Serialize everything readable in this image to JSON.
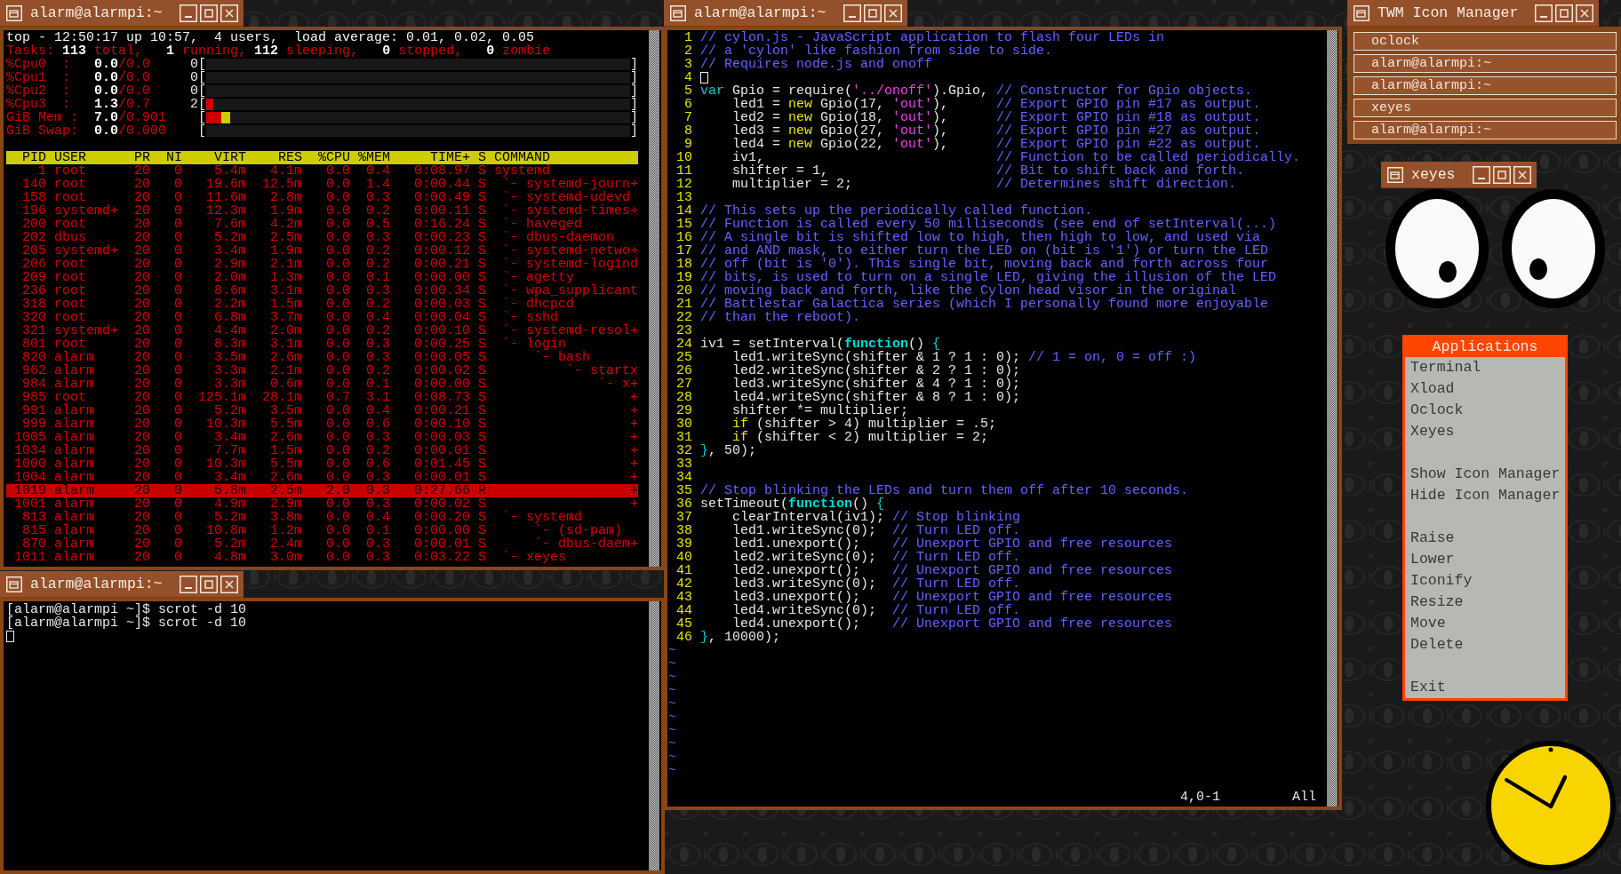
{
  "top_window": {
    "title": "alarm@alarmpi:~",
    "summary": "top - 12:50:17 up 10:57,  4 users,  load average: 0.01, 0.02, 0.05",
    "tasks": "Tasks: **113** total,   **1** running, **112** sleeping,   **0** stopped,   **0** zombie",
    "meters": [
      {
        "label": "%Cpu0  :",
        "reading": "**0.0**/0.0",
        "start": "0[",
        "end": "]"
      },
      {
        "label": "%Cpu1  :",
        "reading": "**0.0**/0.0",
        "start": "0[",
        "end": "]"
      },
      {
        "label": "%Cpu2  :",
        "reading": "**0.0**/0.0",
        "start": "0[",
        "end": "]"
      },
      {
        "label": "%Cpu3  :",
        "reading": "**1.3**/0.7",
        "start": "2[",
        "end": "]",
        "segments": [
          {
            "color": "#cd0000",
            "level": 0.017
          }
        ]
      },
      {
        "label": "GiB Mem :",
        "reading": "**7.0**/0.901",
        "start": "[",
        "end": "]",
        "segments": [
          {
            "color": "#cd0000",
            "level": 0.036
          },
          {
            "color": "#cdcd00",
            "level": 0.02
          }
        ]
      },
      {
        "label": "GiB Swap:",
        "reading": "**0.0**/0.000",
        "start": "[",
        "end": "]"
      }
    ],
    "table": {
      "columns": [
        "PID",
        "USER",
        "PR",
        "NI",
        "VIRT",
        "RES",
        "%CPU",
        "%MEM",
        "TIME+",
        "S",
        "COMMAND"
      ],
      "rows": [
        {
          "cells": [
            "1",
            "root",
            "20",
            "0",
            "5.4m",
            "4.1m",
            "0.0",
            "0.4",
            "0:08.97",
            "S"
          ],
          "command": "systemd",
          "highlighted": false,
          "children": [
            {
              "cells": [
                "140",
                "root",
                "20",
                "0",
                "19.6m",
                "12.5m",
                "0.0",
                "1.4",
                "0:00.44",
                "S"
              ],
              "command": "`- systemd-journ+",
              "highlighted": false
            },
            {
              "cells": [
                "158",
                "root",
                "20",
                "0",
                "11.6m",
                "2.8m",
                "0.0",
                "0.3",
                "0:00.49",
                "S"
              ],
              "command": "`- systemd-udevd",
              "highlighted": false
            },
            {
              "cells": [
                "196",
                "systemd+",
                "20",
                "0",
                "12.3m",
                "1.9m",
                "0.0",
                "0.2",
                "0:00.11",
                "S"
              ],
              "command": "`- systemd-times+",
              "highlighted": false
            },
            {
              "cells": [
                "200",
                "root",
                "20",
                "0",
                "7.6m",
                "4.2m",
                "0.0",
                "0.5",
                "0:16.24",
                "S"
              ],
              "command": "`- haveged",
              "highlighted": false
            },
            {
              "cells": [
                "202",
                "dbus",
                "20",
                "0",
                "5.2m",
                "2.5m",
                "0.0",
                "0.3",
                "0:00.23",
                "S"
              ],
              "command": "`- dbus-daemon",
              "highlighted": false
            },
            {
              "cells": [
                "205",
                "systemd+",
                "20",
                "0",
                "3.4m",
                "1.9m",
                "0.0",
                "0.2",
                "0:00.12",
                "S"
              ],
              "command": "`- systemd-netwo+",
              "highlighted": false
            },
            {
              "cells": [
                "206",
                "root",
                "20",
                "0",
                "2.9m",
                "2.1m",
                "0.0",
                "0.2",
                "0:00.21",
                "S"
              ],
              "command": "`- systemd-logind",
              "highlighted": false
            },
            {
              "cells": [
                "209",
                "root",
                "20",
                "0",
                "2.0m",
                "1.3m",
                "0.0",
                "0.1",
                "0:00.00",
                "S"
              ],
              "command": "`- agetty",
              "highlighted": false
            },
            {
              "cells": [
                "236",
                "root",
                "20",
                "0",
                "8.6m",
                "3.1m",
                "0.0",
                "0.3",
                "0:00.34",
                "S"
              ],
              "command": "`- wpa_supplicant",
              "highlighted": false
            },
            {
              "cells": [
                "318",
                "root",
                "20",
                "0",
                "2.2m",
                "1.5m",
                "0.0",
                "0.2",
                "0:00.03",
                "S"
              ],
              "command": "`- dhcpcd",
              "highlighted": false
            },
            {
              "cells": [
                "320",
                "root",
                "20",
                "0",
                "6.8m",
                "3.7m",
                "0.0",
                "0.4",
                "0:00.04",
                "S"
              ],
              "command": "`- sshd",
              "highlighted": false
            },
            {
              "cells": [
                "321",
                "systemd+",
                "20",
                "0",
                "4.4m",
                "2.0m",
                "0.0",
                "0.2",
                "0:00.10",
                "S"
              ],
              "command": "`- systemd-resol+",
              "highlighted": false
            },
            {
              "cells": [
                "801",
                "root",
                "20",
                "0",
                "8.3m",
                "3.1m",
                "0.0",
                "0.3",
                "0:00.25",
                "S"
              ],
              "command": "`- login",
              "highlighted": false,
              "children": [
                {
                  "cells": [
                    "820",
                    "alarm",
                    "20",
                    "0",
                    "3.5m",
                    "2.6m",
                    "0.0",
                    "0.3",
                    "0:00.05",
                    "S"
                  ],
                  "command": "`- bash",
                  "highlighted": false,
                  "children": [
                    {
                      "cells": [
                        "962",
                        "alarm",
                        "20",
                        "0",
                        "3.3m",
                        "2.1m",
                        "0.0",
                        "0.2",
                        "0:00.02",
                        "S"
                      ],
                      "command": "`- startx",
                      "highlighted": false,
                      "children": [
                        {
                          "cells": [
                            "984",
                            "alarm",
                            "20",
                            "0",
                            "3.3m",
                            "0.6m",
                            "0.0",
                            "0.1",
                            "0:00.00",
                            "S"
                          ],
                          "command": "`- x+",
                          "highlighted": false,
                          "children": [
                            {
                              "cells": [
                                "985",
                                "root",
                                "20",
                                "0",
                                "125.1m",
                                "28.1m",
                                "0.7",
                                "3.1",
                                "0:08.73",
                                "S"
                              ],
                              "command": "+",
                              "highlighted": false
                            },
                            {
                              "cells": [
                                "991",
                                "alarm",
                                "20",
                                "0",
                                "5.2m",
                                "3.5m",
                                "0.0",
                                "0.4",
                                "0:00.21",
                                "S"
                              ],
                              "command": "+",
                              "highlighted": false
                            },
                            {
                              "cells": [
                                "999",
                                "alarm",
                                "20",
                                "0",
                                "10.3m",
                                "5.5m",
                                "0.0",
                                "0.6",
                                "0:00.10",
                                "S"
                              ],
                              "command": "+",
                              "highlighted": false
                            },
                            {
                              "cells": [
                                "1005",
                                "alarm",
                                "20",
                                "0",
                                "3.4m",
                                "2.6m",
                                "0.0",
                                "0.3",
                                "0:00.03",
                                "S"
                              ],
                              "command": "+",
                              "highlighted": false
                            },
                            {
                              "cells": [
                                "1034",
                                "alarm",
                                "20",
                                "0",
                                "7.7m",
                                "1.5m",
                                "0.0",
                                "0.2",
                                "0:00.01",
                                "S"
                              ],
                              "command": "+",
                              "highlighted": false
                            },
                            {
                              "cells": [
                                "1000",
                                "alarm",
                                "20",
                                "0",
                                "10.3m",
                                "5.5m",
                                "0.0",
                                "0.6",
                                "0:01.45",
                                "S"
                              ],
                              "command": "+",
                              "highlighted": false
                            },
                            {
                              "cells": [
                                "1004",
                                "alarm",
                                "20",
                                "0",
                                "3.4m",
                                "2.6m",
                                "0.0",
                                "0.3",
                                "0:00.01",
                                "S"
                              ],
                              "command": "+",
                              "highlighted": false
                            },
                            {
                              "cells": [
                                "1019",
                                "alarm",
                                "20",
                                "0",
                                "5.8m",
                                "2.5m",
                                "2.0",
                                "0.3",
                                "0:27.66",
                                "R"
                              ],
                              "command": "+",
                              "highlighted": true
                            },
                            {
                              "cells": [
                                "1001",
                                "alarm",
                                "20",
                                "0",
                                "4.9m",
                                "2.9m",
                                "0.0",
                                "0.3",
                                "0:00.02",
                                "S"
                              ],
                              "command": "+",
                              "highlighted": false
                            }
                          ]
                        }
                      ]
                    }
                  ]
                }
              ]
            },
            {
              "cells": [
                "813",
                "alarm",
                "20",
                "0",
                "5.2m",
                "3.8m",
                "0.0",
                "0.4",
                "0:00.20",
                "S"
              ],
              "command": "`- systemd",
              "highlighted": false,
              "children": [
                {
                  "cells": [
                    "815",
                    "alarm",
                    "20",
                    "0",
                    "10.8m",
                    "1.2m",
                    "0.0",
                    "0.1",
                    "0:00.00",
                    "S"
                  ],
                  "command": "`- (sd-pam)",
                  "highlighted": false
                },
                {
                  "cells": [
                    "870",
                    "alarm",
                    "20",
                    "0",
                    "5.2m",
                    "2.4m",
                    "0.0",
                    "0.3",
                    "0:00.01",
                    "S"
                  ],
                  "command": "`- dbus-daem+",
                  "highlighted": false
                }
              ]
            },
            {
              "cells": [
                "1011",
                "alarm",
                "20",
                "0",
                "4.8m",
                "3.0m",
                "0.0",
                "0.3",
                "0:03.22",
                "S"
              ],
              "command": "`- xeyes",
              "highlighted": false
            }
          ]
        }
      ]
    }
  },
  "code_window": {
    "title": "alarm@alarmpi:~",
    "lines": [
      {
        "number": "1",
        "tokens": [
          {
            "kind": "comment",
            "text": "// cylon.js - JavaScript application to flash four LEDs in"
          }
        ]
      },
      {
        "number": "2",
        "tokens": [
          {
            "kind": "comment",
            "text": "// a 'cylon' like fashion from side to side."
          }
        ]
      },
      {
        "number": "3",
        "tokens": [
          {
            "kind": "comment",
            "text": "// Requires node.js and onoff"
          }
        ]
      },
      {
        "number": "4",
        "tokens": [
          {
            "kind": "cursor"
          }
        ]
      },
      {
        "number": "5",
        "tokens": [
          {
            "kind": "keyword",
            "text": "var"
          },
          {
            "kind": "plain",
            "text": " Gpio = require("
          },
          {
            "kind": "string",
            "text": "'../onoff'"
          },
          {
            "kind": "plain",
            "text": ").Gpio, "
          },
          {
            "kind": "comment",
            "text": "// Constructor for Gpio objects."
          }
        ]
      },
      {
        "number": "6",
        "tokens": [
          {
            "kind": "plain",
            "text": "    led1 = "
          },
          {
            "kind": "statement",
            "text": "new"
          },
          {
            "kind": "plain",
            "text": " Gpio(17, "
          },
          {
            "kind": "string",
            "text": "'out'"
          },
          {
            "kind": "plain",
            "text": "),      "
          },
          {
            "kind": "comment",
            "text": "// Export GPIO pin #17 as output."
          }
        ]
      },
      {
        "number": "7",
        "tokens": [
          {
            "kind": "plain",
            "text": "    led2 = "
          },
          {
            "kind": "statement",
            "text": "new"
          },
          {
            "kind": "plain",
            "text": " Gpio(18, "
          },
          {
            "kind": "string",
            "text": "'out'"
          },
          {
            "kind": "plain",
            "text": "),      "
          },
          {
            "kind": "comment",
            "text": "// Export GPIO pin #18 as output."
          }
        ]
      },
      {
        "number": "8",
        "tokens": [
          {
            "kind": "plain",
            "text": "    led3 = "
          },
          {
            "kind": "statement",
            "text": "new"
          },
          {
            "kind": "plain",
            "text": " Gpio(27, "
          },
          {
            "kind": "string",
            "text": "'out'"
          },
          {
            "kind": "plain",
            "text": "),      "
          },
          {
            "kind": "comment",
            "text": "// Export GPIO pin #27 as output."
          }
        ]
      },
      {
        "number": "9",
        "tokens": [
          {
            "kind": "plain",
            "text": "    led4 = "
          },
          {
            "kind": "statement",
            "text": "new"
          },
          {
            "kind": "plain",
            "text": " Gpio(22, "
          },
          {
            "kind": "string",
            "text": "'out'"
          },
          {
            "kind": "plain",
            "text": "),      "
          },
          {
            "kind": "comment",
            "text": "// Export GPIO pin #22 as output."
          }
        ]
      },
      {
        "number": "10",
        "tokens": [
          {
            "kind": "plain",
            "text": "    iv1,                             "
          },
          {
            "kind": "comment",
            "text": "// Function to be called periodically."
          }
        ]
      },
      {
        "number": "11",
        "tokens": [
          {
            "kind": "plain",
            "text": "    shifter = 1,                     "
          },
          {
            "kind": "comment",
            "text": "// Bit to shift back and forth."
          }
        ]
      },
      {
        "number": "12",
        "tokens": [
          {
            "kind": "plain",
            "text": "    multiplier = 2;                  "
          },
          {
            "kind": "comment",
            "text": "// Determines shift direction."
          }
        ]
      },
      {
        "number": "13"
      },
      {
        "number": "14",
        "tokens": [
          {
            "kind": "comment",
            "text": "// This sets up the periodically called function."
          }
        ]
      },
      {
        "number": "15",
        "tokens": [
          {
            "kind": "comment",
            "text": "// Function is called every 50 milliseconds (see end of setInterval(...)"
          }
        ]
      },
      {
        "number": "16",
        "tokens": [
          {
            "kind": "comment",
            "text": "// A single bit is shifted low to high, then high to low, and used via"
          }
        ]
      },
      {
        "number": "17",
        "tokens": [
          {
            "kind": "comment",
            "text": "// and AND mask, to either turn the LED on (bit is '1') or turn the LED"
          }
        ]
      },
      {
        "number": "18",
        "tokens": [
          {
            "kind": "comment",
            "text": "// off (bit is '0'). This single bit, moving back and forth across four"
          }
        ]
      },
      {
        "number": "19",
        "tokens": [
          {
            "kind": "comment",
            "text": "// bits, is used to turn on a single LED, giving the illusion of the LED"
          }
        ]
      },
      {
        "number": "20",
        "tokens": [
          {
            "kind": "comment",
            "text": "// moving back and forth, like the Cylon head visor in the original"
          }
        ]
      },
      {
        "number": "21",
        "tokens": [
          {
            "kind": "comment",
            "text": "// Battlestar Galactica series (which I personally found more enjoyable"
          }
        ]
      },
      {
        "number": "22",
        "tokens": [
          {
            "kind": "comment",
            "text": "// than the reboot)."
          }
        ]
      },
      {
        "number": "23"
      },
      {
        "number": "24",
        "tokens": [
          {
            "kind": "plain",
            "text": "iv1 = setInterval("
          },
          {
            "kind": "function",
            "text": "function"
          },
          {
            "kind": "plain",
            "text": "() "
          },
          {
            "kind": "brace",
            "text": "{"
          }
        ]
      },
      {
        "number": "25",
        "tokens": [
          {
            "kind": "plain",
            "text": "    led1.writeSync(shifter & 1 ? 1 : 0); "
          },
          {
            "kind": "comment",
            "text": "// 1 = on, 0 = off :)"
          }
        ]
      },
      {
        "number": "26",
        "tokens": [
          {
            "kind": "plain",
            "text": "    led2.writeSync(shifter & 2 ? 1 : 0);"
          }
        ]
      },
      {
        "number": "27",
        "tokens": [
          {
            "kind": "plain",
            "text": "    led3.writeSync(shifter & 4 ? 1 : 0);"
          }
        ]
      },
      {
        "number": "28",
        "tokens": [
          {
            "kind": "plain",
            "text": "    led4.writeSync(shifter & 8 ? 1 : 0);"
          }
        ]
      },
      {
        "number": "29",
        "tokens": [
          {
            "kind": "plain",
            "text": "    shifter *= multiplier;"
          }
        ]
      },
      {
        "number": "30",
        "tokens": [
          {
            "kind": "statement",
            "text": "    if"
          },
          {
            "kind": "plain",
            "text": " (shifter > 4) multiplier = .5;"
          }
        ]
      },
      {
        "number": "31",
        "tokens": [
          {
            "kind": "statement",
            "text": "    if"
          },
          {
            "kind": "plain",
            "text": " (shifter < 2) multiplier = 2;"
          }
        ]
      },
      {
        "number": "32",
        "tokens": [
          {
            "kind": "brace",
            "text": "}"
          },
          {
            "kind": "plain",
            "text": ", 50);"
          }
        ]
      },
      {
        "number": "33"
      },
      {
        "number": "34"
      },
      {
        "number": "35",
        "tokens": [
          {
            "kind": "comment",
            "text": "// Stop blinking the LEDs and turn them off after 10 seconds."
          }
        ]
      },
      {
        "number": "36",
        "tokens": [
          {
            "kind": "plain",
            "text": "setTimeout("
          },
          {
            "kind": "function",
            "text": "function"
          },
          {
            "kind": "plain",
            "text": "() "
          },
          {
            "kind": "brace",
            "text": "{"
          }
        ]
      },
      {
        "number": "37",
        "tokens": [
          {
            "kind": "plain",
            "text": "    clearInterval(iv1); "
          },
          {
            "kind": "comment",
            "text": "// Stop blinking"
          }
        ]
      },
      {
        "number": "38",
        "tokens": [
          {
            "kind": "plain",
            "text": "    led1.writeSync(0);  "
          },
          {
            "kind": "comment",
            "text": "// Turn LED off."
          }
        ]
      },
      {
        "number": "39",
        "tokens": [
          {
            "kind": "plain",
            "text": "    led1.unexport();    "
          },
          {
            "kind": "comment",
            "text": "// Unexport GPIO and free resources"
          }
        ]
      },
      {
        "number": "40",
        "tokens": [
          {
            "kind": "plain",
            "text": "    led2.writeSync(0);  "
          },
          {
            "kind": "comment",
            "text": "// Turn LED off."
          }
        ]
      },
      {
        "number": "41",
        "tokens": [
          {
            "kind": "plain",
            "text": "    led2.unexport();    "
          },
          {
            "kind": "comment",
            "text": "// Unexport GPIO and free resources"
          }
        ]
      },
      {
        "number": "42",
        "tokens": [
          {
            "kind": "plain",
            "text": "    led3.writeSync(0);  "
          },
          {
            "kind": "comment",
            "text": "// Turn LED off."
          }
        ]
      },
      {
        "number": "43",
        "tokens": [
          {
            "kind": "plain",
            "text": "    led3.unexport();    "
          },
          {
            "kind": "comment",
            "text": "// Unexport GPIO and free resources"
          }
        ]
      },
      {
        "number": "44",
        "tokens": [
          {
            "kind": "plain",
            "text": "    led4.writeSync(0);  "
          },
          {
            "kind": "comment",
            "text": "// Turn LED off."
          }
        ]
      },
      {
        "number": "45",
        "tokens": [
          {
            "kind": "plain",
            "text": "    led4.unexport();    "
          },
          {
            "kind": "comment",
            "text": "// Unexport GPIO and free resources"
          }
        ]
      },
      {
        "number": "46",
        "tokens": [
          {
            "kind": "brace",
            "text": "}"
          },
          {
            "kind": "plain",
            "text": ", 10000);"
          }
        ]
      }
    ],
    "filler_lines": [
      "~",
      "~",
      "~",
      "~",
      "~",
      "~",
      "~",
      "~",
      "~",
      "~"
    ],
    "status": {
      "position": "4,0-1",
      "scroll": "All"
    }
  },
  "icon_manager": {
    "title": "TWM Icon Manager",
    "entries": [
      "oclock",
      "alarm@alarmpi:~",
      "alarm@alarmpi:~",
      "xeyes",
      "alarm@alarmpi:~"
    ]
  },
  "xeyes": {
    "title": "xeyes"
  },
  "menu": {
    "title": "Applications",
    "sections": [
      {
        "items": [
          "Terminal",
          "Xload",
          "Oclock",
          "Xeyes"
        ]
      },
      {
        "items": [
          "Show Icon Manager",
          "Hide Icon Manager"
        ]
      },
      {
        "items": [
          "Raise",
          "Lower",
          "Iconify",
          "Resize",
          "Move",
          "Delete"
        ]
      },
      {
        "items": [
          "Exit"
        ]
      }
    ]
  },
  "shell_window": {
    "title": "alarm@alarmpi:~",
    "lines": [
      {
        "kind": "text",
        "text": "[alarm@alarmpi ~]$ scrot -d 10"
      },
      {
        "kind": "text",
        "text": "[alarm@alarmpi ~]$ scrot -d 10"
      },
      {
        "kind": "cursor"
      }
    ]
  }
}
